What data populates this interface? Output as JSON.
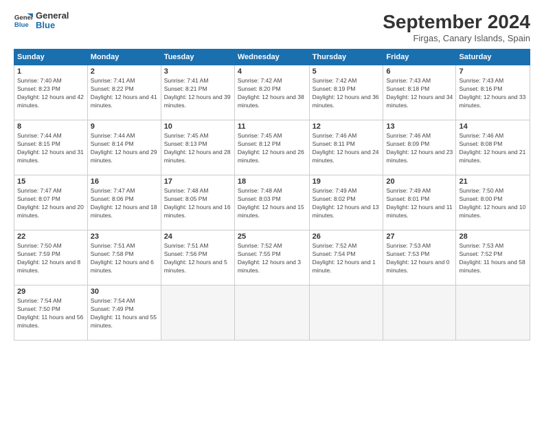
{
  "logo": {
    "line1": "General",
    "line2": "Blue"
  },
  "title": "September 2024",
  "location": "Firgas, Canary Islands, Spain",
  "days_header": [
    "Sunday",
    "Monday",
    "Tuesday",
    "Wednesday",
    "Thursday",
    "Friday",
    "Saturday"
  ],
  "weeks": [
    [
      {
        "day": "1",
        "sunrise": "7:40 AM",
        "sunset": "8:23 PM",
        "daylight": "12 hours and 42 minutes."
      },
      {
        "day": "2",
        "sunrise": "7:41 AM",
        "sunset": "8:22 PM",
        "daylight": "12 hours and 41 minutes."
      },
      {
        "day": "3",
        "sunrise": "7:41 AM",
        "sunset": "8:21 PM",
        "daylight": "12 hours and 39 minutes."
      },
      {
        "day": "4",
        "sunrise": "7:42 AM",
        "sunset": "8:20 PM",
        "daylight": "12 hours and 38 minutes."
      },
      {
        "day": "5",
        "sunrise": "7:42 AM",
        "sunset": "8:19 PM",
        "daylight": "12 hours and 36 minutes."
      },
      {
        "day": "6",
        "sunrise": "7:43 AM",
        "sunset": "8:18 PM",
        "daylight": "12 hours and 34 minutes."
      },
      {
        "day": "7",
        "sunrise": "7:43 AM",
        "sunset": "8:16 PM",
        "daylight": "12 hours and 33 minutes."
      }
    ],
    [
      {
        "day": "8",
        "sunrise": "7:44 AM",
        "sunset": "8:15 PM",
        "daylight": "12 hours and 31 minutes."
      },
      {
        "day": "9",
        "sunrise": "7:44 AM",
        "sunset": "8:14 PM",
        "daylight": "12 hours and 29 minutes."
      },
      {
        "day": "10",
        "sunrise": "7:45 AM",
        "sunset": "8:13 PM",
        "daylight": "12 hours and 28 minutes."
      },
      {
        "day": "11",
        "sunrise": "7:45 AM",
        "sunset": "8:12 PM",
        "daylight": "12 hours and 26 minutes."
      },
      {
        "day": "12",
        "sunrise": "7:46 AM",
        "sunset": "8:11 PM",
        "daylight": "12 hours and 24 minutes."
      },
      {
        "day": "13",
        "sunrise": "7:46 AM",
        "sunset": "8:09 PM",
        "daylight": "12 hours and 23 minutes."
      },
      {
        "day": "14",
        "sunrise": "7:46 AM",
        "sunset": "8:08 PM",
        "daylight": "12 hours and 21 minutes."
      }
    ],
    [
      {
        "day": "15",
        "sunrise": "7:47 AM",
        "sunset": "8:07 PM",
        "daylight": "12 hours and 20 minutes."
      },
      {
        "day": "16",
        "sunrise": "7:47 AM",
        "sunset": "8:06 PM",
        "daylight": "12 hours and 18 minutes."
      },
      {
        "day": "17",
        "sunrise": "7:48 AM",
        "sunset": "8:05 PM",
        "daylight": "12 hours and 16 minutes."
      },
      {
        "day": "18",
        "sunrise": "7:48 AM",
        "sunset": "8:03 PM",
        "daylight": "12 hours and 15 minutes."
      },
      {
        "day": "19",
        "sunrise": "7:49 AM",
        "sunset": "8:02 PM",
        "daylight": "12 hours and 13 minutes."
      },
      {
        "day": "20",
        "sunrise": "7:49 AM",
        "sunset": "8:01 PM",
        "daylight": "12 hours and 11 minutes."
      },
      {
        "day": "21",
        "sunrise": "7:50 AM",
        "sunset": "8:00 PM",
        "daylight": "12 hours and 10 minutes."
      }
    ],
    [
      {
        "day": "22",
        "sunrise": "7:50 AM",
        "sunset": "7:59 PM",
        "daylight": "12 hours and 8 minutes."
      },
      {
        "day": "23",
        "sunrise": "7:51 AM",
        "sunset": "7:58 PM",
        "daylight": "12 hours and 6 minutes."
      },
      {
        "day": "24",
        "sunrise": "7:51 AM",
        "sunset": "7:56 PM",
        "daylight": "12 hours and 5 minutes."
      },
      {
        "day": "25",
        "sunrise": "7:52 AM",
        "sunset": "7:55 PM",
        "daylight": "12 hours and 3 minutes."
      },
      {
        "day": "26",
        "sunrise": "7:52 AM",
        "sunset": "7:54 PM",
        "daylight": "12 hours and 1 minute."
      },
      {
        "day": "27",
        "sunrise": "7:53 AM",
        "sunset": "7:53 PM",
        "daylight": "12 hours and 0 minutes."
      },
      {
        "day": "28",
        "sunrise": "7:53 AM",
        "sunset": "7:52 PM",
        "daylight": "11 hours and 58 minutes."
      }
    ],
    [
      {
        "day": "29",
        "sunrise": "7:54 AM",
        "sunset": "7:50 PM",
        "daylight": "11 hours and 56 minutes."
      },
      {
        "day": "30",
        "sunrise": "7:54 AM",
        "sunset": "7:49 PM",
        "daylight": "11 hours and 55 minutes."
      },
      null,
      null,
      null,
      null,
      null
    ]
  ]
}
